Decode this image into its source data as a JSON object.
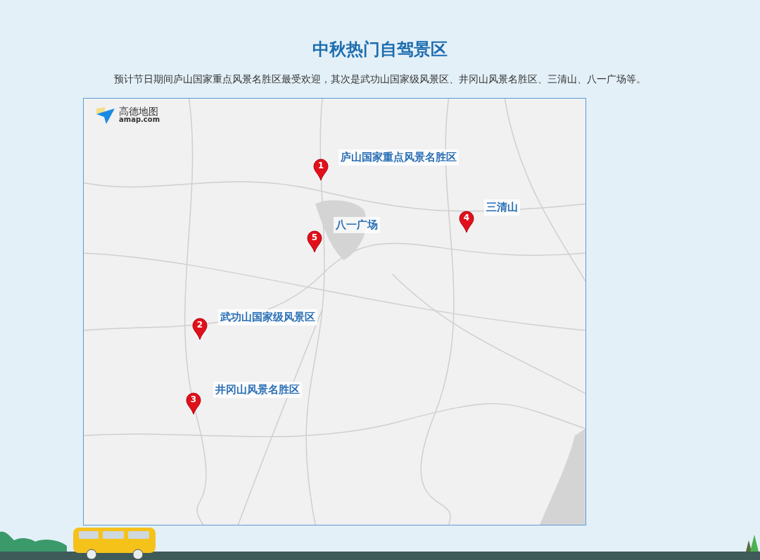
{
  "title": "中秋热门自驾景区",
  "description": "预计节日期间庐山国家重点风景名胜区最受欢迎，其次是武功山国家级风景区、井冈山风景名胜区、三清山、八一广场等。",
  "map": {
    "logo": {
      "name": "高德地图",
      "domain": "amap.com"
    },
    "markers": [
      {
        "number": "1",
        "label": "庐山国家重点风景名胜区"
      },
      {
        "number": "4",
        "label": "三清山"
      },
      {
        "number": "5",
        "label": "八一广场"
      },
      {
        "number": "2",
        "label": "武功山国家级风景区"
      },
      {
        "number": "3",
        "label": "井冈山风景名胜区"
      }
    ]
  }
}
